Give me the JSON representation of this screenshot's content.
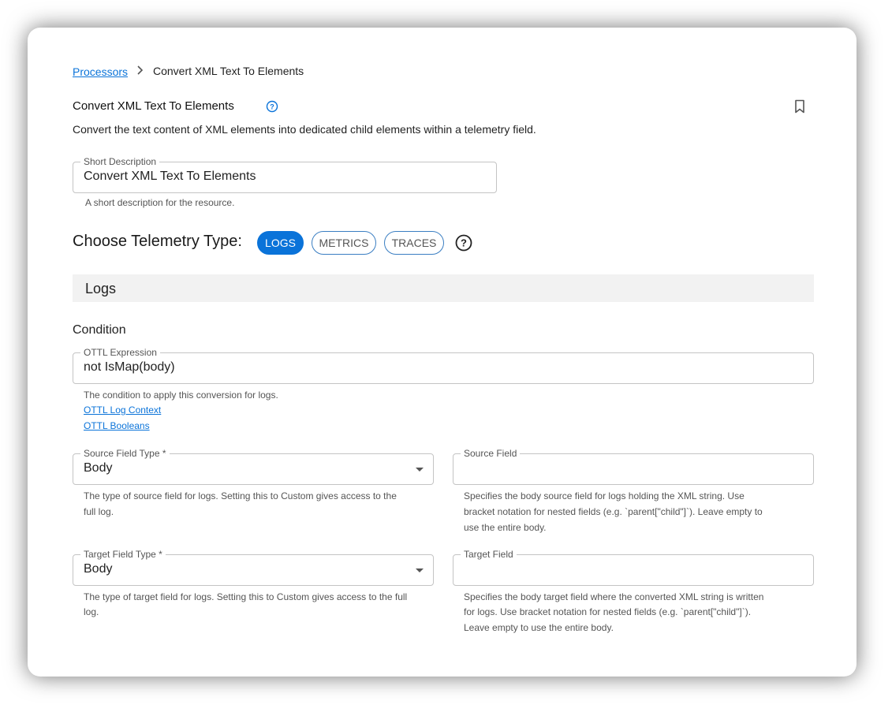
{
  "breadcrumb": {
    "parent": "Processors",
    "current": "Convert XML Text To Elements"
  },
  "page": {
    "title": "Convert XML Text To Elements",
    "description": "Convert the text content of XML elements into dedicated child elements within a telemetry field."
  },
  "short_description": {
    "label": "Short Description",
    "value": "Convert XML Text To Elements",
    "helper": "A short description for the resource."
  },
  "telemetry": {
    "label": "Choose Telemetry Type:",
    "options": [
      "LOGS",
      "METRICS",
      "TRACES"
    ],
    "selected": "LOGS"
  },
  "logs_section": {
    "title": "Logs",
    "condition_title": "Condition",
    "ottl": {
      "label": "OTTL Expression",
      "value": "not IsMap(body)",
      "helper": "The condition to apply this conversion for logs.",
      "links": [
        "OTTL Log Context",
        "OTTL Booleans"
      ]
    },
    "source_field_type": {
      "label": "Source Field Type *",
      "value": "Body",
      "helper_line1": "The type of source field for logs. Setting this to Custom gives access to the",
      "helper_line2": "full log."
    },
    "source_field": {
      "label": "Source Field",
      "value": "",
      "helper_line1": "Specifies the body source field for logs holding the XML string. Use",
      "helper_line2": "bracket notation for nested fields (e.g. `parent[\"child\"]`). Leave empty to",
      "helper_line3": "use the entire body."
    },
    "target_field_type": {
      "label": "Target Field Type *",
      "value": "Body",
      "helper_line1": "The type of target field for logs. Setting this to Custom gives access to the full",
      "helper_line2": "log."
    },
    "target_field": {
      "label": "Target Field",
      "value": "",
      "helper_line1": "Specifies the body target field where the converted XML string is written",
      "helper_line2": "for logs. Use bracket notation for nested fields (e.g. `parent[\"child\"]`).",
      "helper_line3": "Leave empty to use the entire body."
    }
  },
  "colors": {
    "accent": "#0a73d9",
    "section_bg": "#f2f2f2",
    "border": "#c4c4c4"
  },
  "icons": [
    "chevron-right-icon",
    "help-circle-icon",
    "bookmark-icon",
    "dropdown-arrow-icon"
  ]
}
